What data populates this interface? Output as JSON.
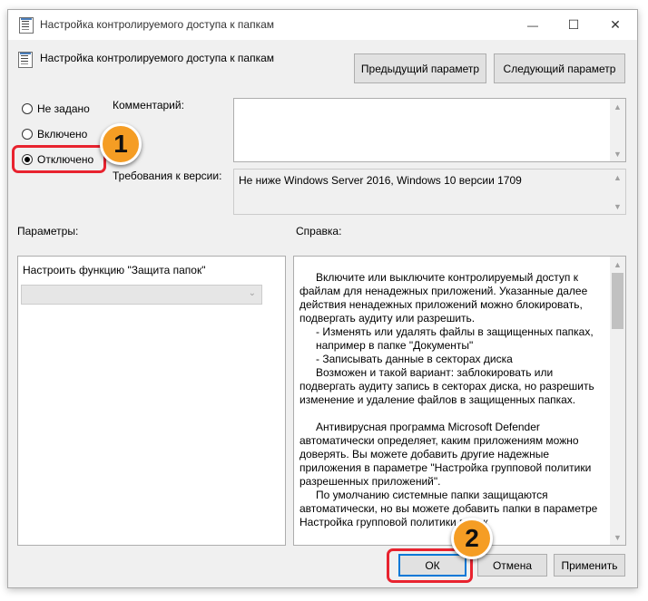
{
  "window": {
    "title": "Настройка контролируемого доступа к папкам",
    "controls": {
      "minimize": "—",
      "maximize": "☐",
      "close": "✕"
    }
  },
  "header": {
    "policy_name": "Настройка контролируемого доступа к папкам",
    "prev_button": "Предыдущий параметр",
    "next_button": "Следующий параметр"
  },
  "state_options": [
    {
      "label": "Не задано",
      "checked": false
    },
    {
      "label": "Включено",
      "checked": false
    },
    {
      "label": "Отключено",
      "checked": true
    }
  ],
  "comment": {
    "label": "Комментарий:",
    "value": ""
  },
  "requirements": {
    "label": "Требования к версии:",
    "value": "Не ниже Windows Server 2016, Windows 10 версии 1709"
  },
  "options": {
    "label": "Параметры:",
    "setting_label": "Настроить функцию \"Защита папок\"",
    "setting_value": ""
  },
  "help": {
    "label": "Справка:",
    "paragraphs": [
      "Включите или выключите контролируемый доступ к файлам для ненадежных приложений. Указанные далее действия ненадежных приложений можно блокировать, подвергать аудиту или разрешить.",
      "- Изменять или удалять файлы в защищенных папках, например в папке \"Документы\"",
      "- Записывать данные в секторах диска",
      "Возможен и такой вариант: заблокировать или подвергать аудиту запись в секторах диска, но разрешить изменение и удаление файлов в защищенных папках.",
      "Антивирусная программа Microsoft Defender автоматически определяет, каким приложениям можно доверять. Вы можете добавить другие надежные приложения в параметре \"Настройка групповой политики разрешенных приложений\".",
      "По умолчанию системные папки защищаются автоматически, но вы можете добавить папки в параметре Настройка групповой политики папок"
    ]
  },
  "footer": {
    "ok": "ОК",
    "cancel": "Отмена",
    "apply": "Применить"
  },
  "annotations": {
    "step1": "1",
    "step2": "2"
  },
  "colors": {
    "highlight": "#e8232f",
    "badge": "#f59d24"
  }
}
